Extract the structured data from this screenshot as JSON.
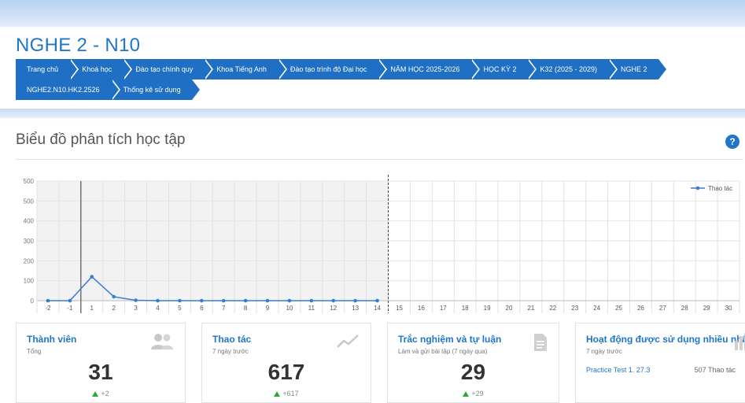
{
  "page": {
    "title": "NGHE 2 - N10"
  },
  "breadcrumbs": {
    "row1": [
      "Trang chủ",
      "Khoá học",
      "Đào tạo chính quy",
      "Khoa Tiếng Anh",
      "Đào tạo trình độ Đại học",
      "NĂM HỌC 2025-2026",
      "HỌC KỲ 2",
      "K32 (2025 - 2029)",
      "NGHE 2"
    ],
    "row2": [
      "NGHE2.N10.HK2.2526",
      "Thống kê sử dụng"
    ]
  },
  "section": {
    "title": "Biểu đồ phân tích học tập",
    "help_icon": "question-circle-icon"
  },
  "chart_data": {
    "type": "line",
    "categories": [
      "-2",
      "-1",
      "1",
      "2",
      "3",
      "4",
      "5",
      "6",
      "7",
      "8",
      "9",
      "10",
      "11",
      "12",
      "13",
      "14",
      "15",
      "16",
      "17",
      "18",
      "19",
      "20",
      "21",
      "22",
      "23",
      "24",
      "25",
      "26",
      "27",
      "28",
      "29",
      "30"
    ],
    "series": [
      {
        "name": "Thao tác",
        "values": [
          0,
          0,
          120,
          20,
          2,
          0,
          0,
          0,
          0,
          0,
          0,
          0,
          0,
          0,
          0,
          0
        ]
      }
    ],
    "y_ticks": [
      "0",
      "100",
      "200",
      "300",
      "400",
      "500",
      "500"
    ],
    "ylim": [
      0,
      600
    ],
    "legend_position": "top-right",
    "grid": true,
    "shaded_through": "14",
    "solid_marker_at": "1",
    "dashed_marker_after": "14",
    "line_color": "#3a7ccf"
  },
  "cards": [
    {
      "title": "Thành viên",
      "sub": "Tổng",
      "value": "31",
      "delta": "+2",
      "icon": "users-icon"
    },
    {
      "title": "Thao tác",
      "sub": "7 ngày trước",
      "value": "617",
      "delta": "+617",
      "icon": "trend-line-icon"
    },
    {
      "title": "Trắc nghiệm và tự luận",
      "sub": "Làm và gửi bài tập (7 ngày qua)",
      "value": "29",
      "delta": "+29",
      "icon": "document-icon"
    },
    {
      "title": "Hoạt động được sử dụng nhiều nhất",
      "sub": "7 ngày trước",
      "activity_name": "Practice Test 1. 27.3",
      "activity_count": "507 Thao tác",
      "icon": "bar-chart-icon"
    }
  ]
}
